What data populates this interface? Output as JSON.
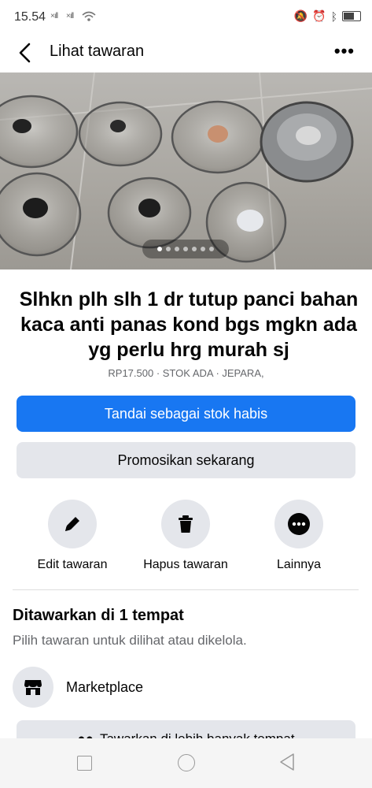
{
  "status": {
    "time": "15.54"
  },
  "appbar": {
    "title": "Lihat tawaran"
  },
  "listing": {
    "title": "Slhkn plh slh 1 dr tutup panci bahan kaca anti panas kond bgs mgkn ada yg perlu hrg murah sj",
    "meta": "RP17.500 · STOK ADA · JEPARA,",
    "photo_count": 7,
    "active_photo": 1
  },
  "buttons": {
    "mark_sold": "Tandai sebagai stok habis",
    "promote": "Promosikan sekarang"
  },
  "actions": [
    {
      "label": "Edit tawaran",
      "icon": "pencil-icon"
    },
    {
      "label": "Hapus tawaran",
      "icon": "trash-icon"
    },
    {
      "label": "Lainnya",
      "icon": "more-icon"
    }
  ],
  "section": {
    "title": "Ditawarkan di 1 tempat",
    "subtitle": "Pilih tawaran untuk dilihat atau dikelola.",
    "place": "Marketplace",
    "more_places_button": "Tawarkan di lebih banyak tempat"
  },
  "colors": {
    "accent": "#1877f2",
    "secondary_bg": "#e4e6eb"
  }
}
